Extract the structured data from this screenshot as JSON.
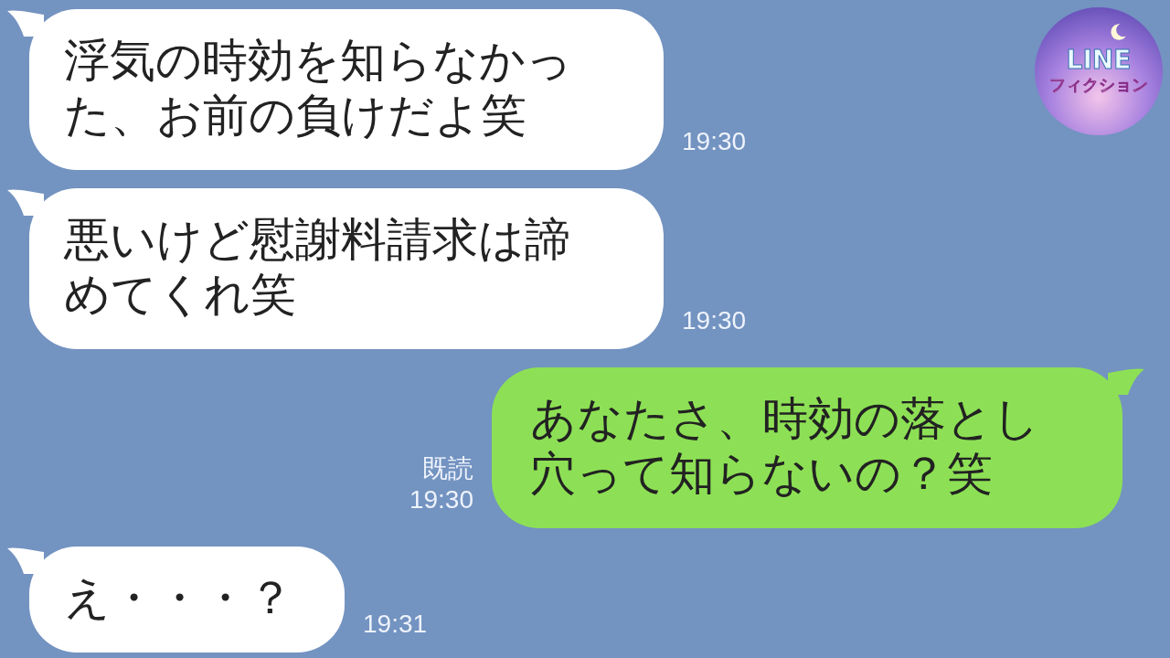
{
  "logo": {
    "title": "LINE",
    "subtitle": "フィクション"
  },
  "messages": [
    {
      "kind": "incoming",
      "text": "浮気の時効を知らなかった、お前の負けだよ笑",
      "time": "19:30"
    },
    {
      "kind": "incoming",
      "text": "悪いけど慰謝料請求は諦めてくれ笑",
      "time": "19:30"
    },
    {
      "kind": "outgoing",
      "text": "あなたさ、時効の落とし穴って知らないの？笑",
      "read": "既読",
      "time": "19:30"
    },
    {
      "kind": "incoming",
      "text": "え・・・？",
      "time": "19:31"
    }
  ]
}
